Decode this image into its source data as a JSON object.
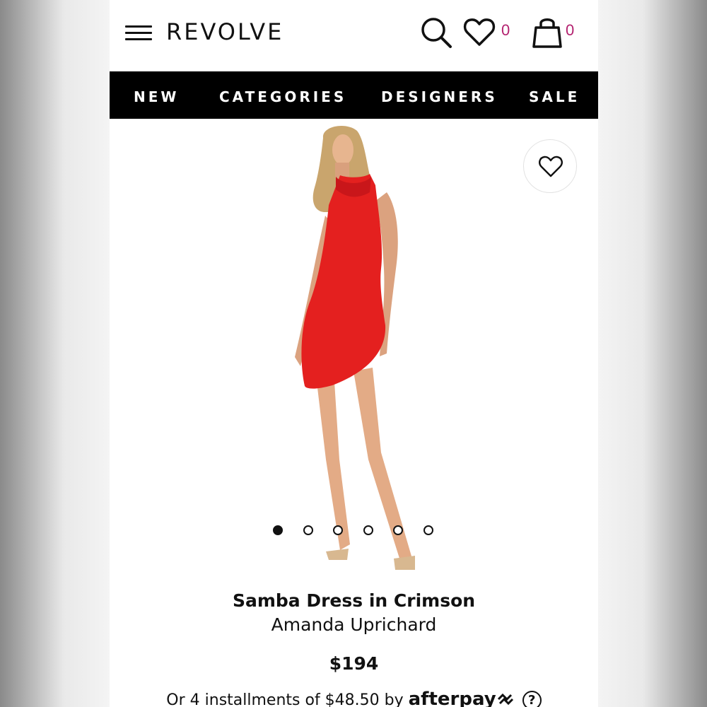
{
  "header": {
    "logo": "REVOLVE",
    "wishlist_count": "0",
    "bag_count": "0"
  },
  "nav": {
    "items": [
      "NEW",
      "CATEGORIES",
      "DESIGNERS",
      "SALE"
    ]
  },
  "gallery": {
    "image_count": 6,
    "active_index": 0
  },
  "product": {
    "name": "Samba Dress in Crimson",
    "designer": "Amanda Uprichard",
    "price": "$194",
    "installments_text": "Or 4 installments of $48.50 by",
    "afterpay_label": "afterpay",
    "help_label": "?"
  },
  "colors": {
    "accent_count": "#b3216f",
    "nav_bg": "#000000",
    "dress": "#e4201f"
  }
}
